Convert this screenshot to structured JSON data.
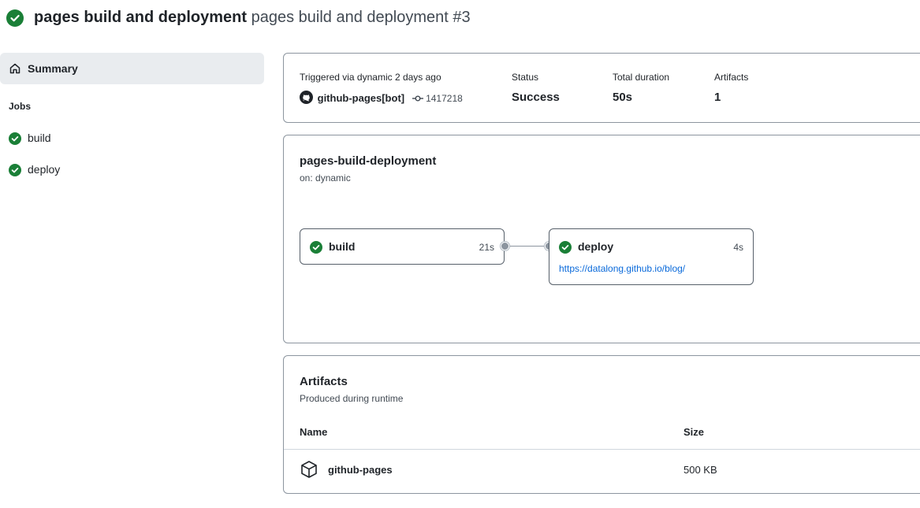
{
  "header": {
    "status_icon": "check-circle-fill-icon",
    "title_bold": "pages build and deployment",
    "title_rest": "pages build and deployment #3"
  },
  "sidebar": {
    "summary_label": "Summary",
    "summary_icon": "home-icon",
    "jobs_heading": "Jobs",
    "jobs": [
      {
        "label": "build",
        "icon": "check-circle-fill-icon"
      },
      {
        "label": "deploy",
        "icon": "check-circle-fill-icon"
      }
    ]
  },
  "summary": {
    "triggered_text": "Triggered via dynamic 2 days ago",
    "actor": "github-pages[bot]",
    "actor_icon": "github-mark-icon",
    "commit_icon": "git-commit-icon",
    "commit": "1417218",
    "status_label": "Status",
    "status_value": "Success",
    "duration_label": "Total duration",
    "duration_value": "50s",
    "artifacts_label": "Artifacts",
    "artifacts_value": "1"
  },
  "workflow": {
    "name": "pages-build-deployment",
    "trigger": "on: dynamic",
    "jobs": [
      {
        "name": "build",
        "duration": "21s"
      },
      {
        "name": "deploy",
        "duration": "4s",
        "url": "https://datalong.github.io/blog/"
      }
    ]
  },
  "artifacts": {
    "title": "Artifacts",
    "subtitle": "Produced during runtime",
    "col_name": "Name",
    "col_size": "Size",
    "rows": [
      {
        "name": "github-pages",
        "size": "500 KB",
        "icon": "package-icon"
      }
    ]
  },
  "colors": {
    "success": "#1a7f37",
    "link": "#0969da",
    "sidebar_selected": "#e9ecef"
  }
}
